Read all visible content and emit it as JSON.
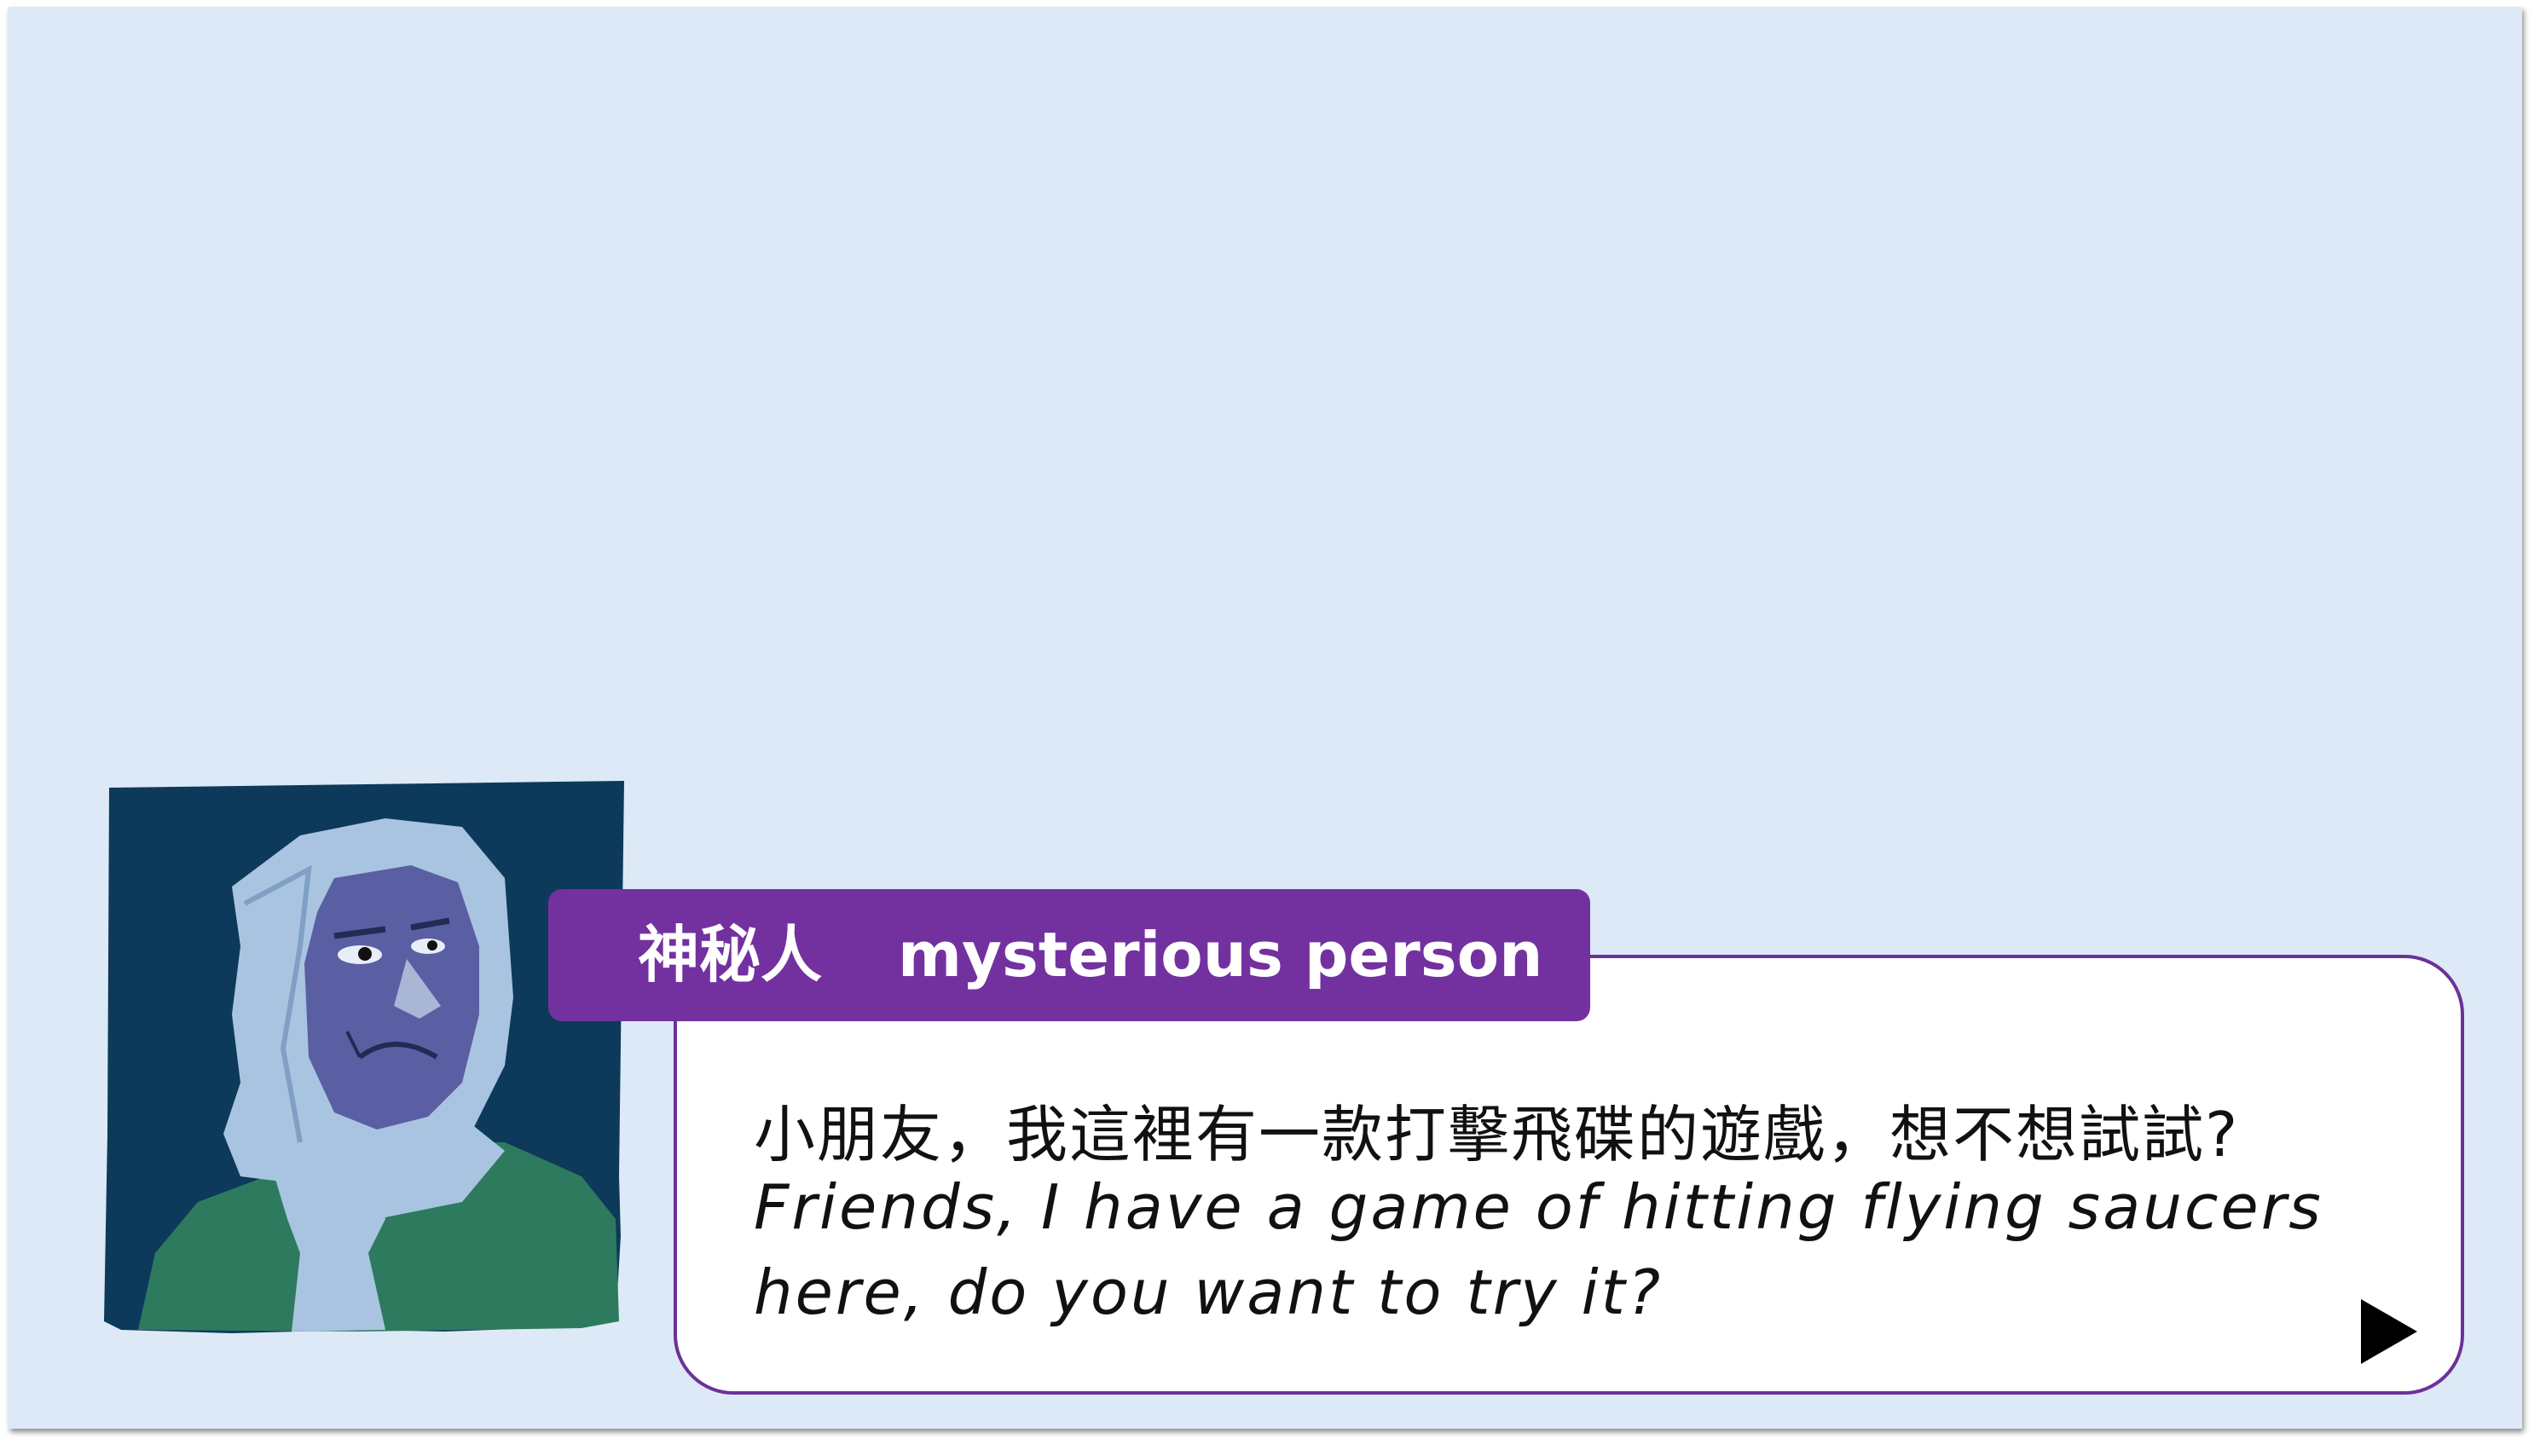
{
  "speaker": {
    "name_zh": "神秘人",
    "name_en": "mysterious person"
  },
  "dialogue": {
    "line_zh": "小朋友，我這裡有一款打擊飛碟的遊戲，想不想試試?",
    "line_en_1": "Friends, I have a game of hitting flying saucers",
    "line_en_2": "here, do you want to try it?"
  },
  "icons": {
    "next": "play-triangle-icon",
    "portrait": "hooded-figure-portrait"
  },
  "colors": {
    "background": "#dde9f6",
    "name_tag": "#7331a0",
    "dialogue_border": "#6c3199",
    "portrait_bg": "#0d3a5a",
    "hood": "#a9c4e0",
    "face": "#5a5fa3",
    "jacket": "#2e7a5e"
  }
}
